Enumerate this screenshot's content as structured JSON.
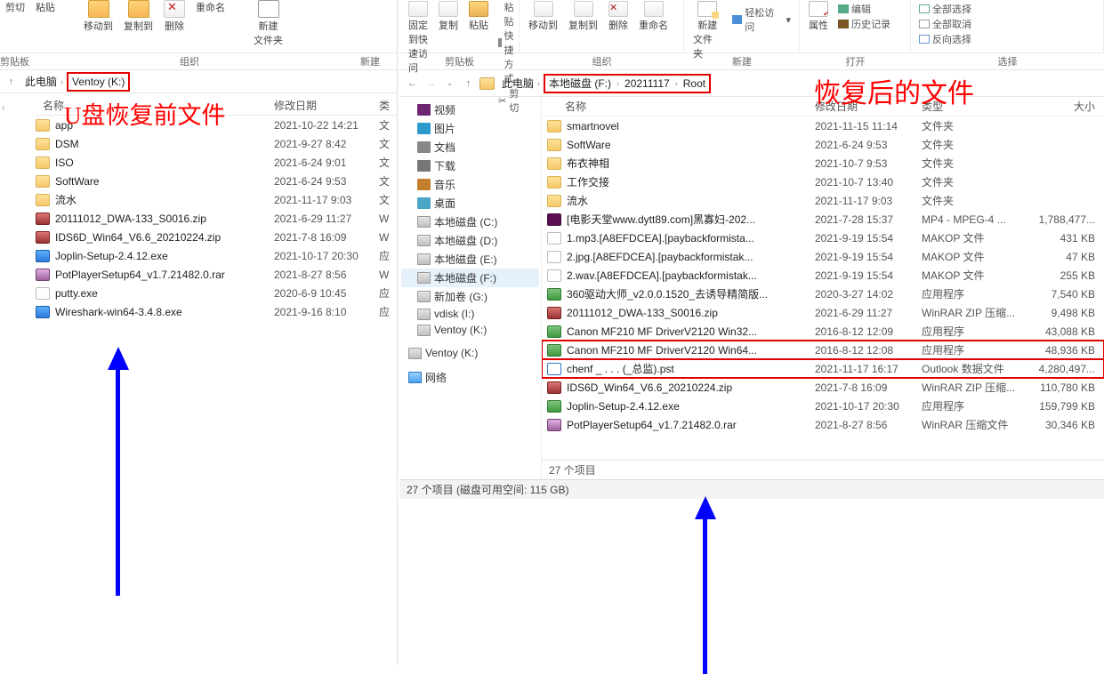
{
  "annotations": {
    "left_label": "U盘恢复前文件",
    "right_label": "恢复后的文件"
  },
  "left": {
    "ribbon": {
      "cut": "剪切",
      "paste": "粘贴",
      "move_to": "移动到",
      "copy_to": "复制到",
      "delete": "删除",
      "rename": "重命名",
      "new_folder_l1": "新建",
      "new_folder_l2": "文件夹",
      "group_clipboard": "剪贴板",
      "group_organize": "组织",
      "group_new": "新建"
    },
    "breadcrumb": {
      "pc": "此电脑",
      "drive": "Ventoy (K:)"
    },
    "header": {
      "name": "名称",
      "date": "修改日期",
      "type": "类"
    },
    "items": [
      {
        "name": "app",
        "date": "2021-10-22 14:21",
        "type": "文",
        "cls": ""
      },
      {
        "name": "DSM",
        "date": "2021-9-27 8:42",
        "type": "文",
        "cls": ""
      },
      {
        "name": "ISO",
        "date": "2021-6-24 9:01",
        "type": "文",
        "cls": ""
      },
      {
        "name": "SoftWare",
        "date": "2021-6-24 9:53",
        "type": "文",
        "cls": ""
      },
      {
        "name": "流水",
        "date": "2021-11-17 9:03",
        "type": "文",
        "cls": ""
      },
      {
        "name": "20111012_DWA-133_S0016.zip",
        "date": "2021-6-29 11:27",
        "type": "W",
        "cls": "zip"
      },
      {
        "name": "IDS6D_Win64_V6.6_20210224.zip",
        "date": "2021-7-8 16:09",
        "type": "W",
        "cls": "zip"
      },
      {
        "name": "Joplin-Setup-2.4.12.exe",
        "date": "2021-10-17 20:30",
        "type": "应",
        "cls": "exe"
      },
      {
        "name": "PotPlayerSetup64_v1.7.21482.0.rar",
        "date": "2021-8-27 8:56",
        "type": "W",
        "cls": "rar"
      },
      {
        "name": "putty.exe",
        "date": "2020-6-9 10:45",
        "type": "应",
        "cls": "generic"
      },
      {
        "name": "Wireshark-win64-3.4.8.exe",
        "date": "2021-9-16 8:10",
        "type": "应",
        "cls": "exe"
      }
    ]
  },
  "right": {
    "ribbon": {
      "pin_l1": "固定到快",
      "pin_l2": "速访问",
      "copy": "复制",
      "paste": "粘贴",
      "paste_shortcut": "粘贴快捷方式",
      "cut": "剪切",
      "move_to": "移动到",
      "copy_to": "复制到",
      "delete": "删除",
      "rename": "重命名",
      "new_folder_l1": "新建",
      "new_folder_l2": "文件夹",
      "easy_access": "轻松访问",
      "properties": "属性",
      "edit": "编辑",
      "history": "历史记录",
      "select_all": "全部选择",
      "select_none": "全部取消",
      "invert": "反向选择",
      "grp_clipboard": "剪贴板",
      "grp_organize": "组织",
      "grp_new": "新建",
      "grp_open": "打开",
      "grp_select": "选择"
    },
    "breadcrumb": {
      "pc": "此电脑",
      "drive": "本地磁盘 (F:)",
      "d1": "20211117",
      "d2": "Root"
    },
    "tree": {
      "video": "视频",
      "pictures": "图片",
      "documents": "文档",
      "downloads": "下载",
      "music": "音乐",
      "desktop": "桌面",
      "c": "本地磁盘 (C:)",
      "d": "本地磁盘 (D:)",
      "e": "本地磁盘 (E:)",
      "f": "本地磁盘 (F:)",
      "g": "新加卷 (G:)",
      "i": "vdisk (I:)",
      "k1": "Ventoy (K:)",
      "k2": "Ventoy (K:)",
      "net": "网络"
    },
    "header": {
      "name": "名称",
      "date": "修改日期",
      "type": "类型",
      "size": "大小"
    },
    "items": [
      {
        "name": "smartnovel",
        "date": "2021-11-15 11:14",
        "type": "文件夹",
        "size": "",
        "cls": ""
      },
      {
        "name": "SoftWare",
        "date": "2021-6-24 9:53",
        "type": "文件夹",
        "size": "",
        "cls": ""
      },
      {
        "name": "布衣神相",
        "date": "2021-10-7 9:53",
        "type": "文件夹",
        "size": "",
        "cls": ""
      },
      {
        "name": "工作交接",
        "date": "2021-10-7 13:40",
        "type": "文件夹",
        "size": "",
        "cls": ""
      },
      {
        "name": "流水",
        "date": "2021-11-17 9:03",
        "type": "文件夹",
        "size": "",
        "cls": ""
      },
      {
        "name": "[电影天堂www.dytt89.com]黑寡妇-202...",
        "date": "2021-7-28 15:37",
        "type": "MP4 - MPEG-4 ...",
        "size": "1,788,477...",
        "cls": "mp4"
      },
      {
        "name": "1.mp3.[A8EFDCEA].[paybackformista...",
        "date": "2021-9-19 15:54",
        "type": "MAKOP 文件",
        "size": "431 KB",
        "cls": "generic"
      },
      {
        "name": "2.jpg.[A8EFDCEA].[paybackformistak...",
        "date": "2021-9-19 15:54",
        "type": "MAKOP 文件",
        "size": "47 KB",
        "cls": "generic"
      },
      {
        "name": "2.wav.[A8EFDCEA].[paybackformistak...",
        "date": "2021-9-19 15:54",
        "type": "MAKOP 文件",
        "size": "255 KB",
        "cls": "generic"
      },
      {
        "name": "360驱动大师_v2.0.0.1520_去诱导精简版...",
        "date": "2020-3-27 14:02",
        "type": "应用程序",
        "size": "7,540 KB",
        "cls": "exe"
      },
      {
        "name": "20111012_DWA-133_S0016.zip",
        "date": "2021-6-29 11:27",
        "type": "WinRAR ZIP 压缩...",
        "size": "9,498 KB",
        "cls": "zip"
      },
      {
        "name": "Canon MF210 MF DriverV2120 Win32...",
        "date": "2016-8-12 12:09",
        "type": "应用程序",
        "size": "43,088 KB",
        "cls": "exe"
      },
      {
        "name": "Canon MF210 MF DriverV2120 Win64...",
        "date": "2016-8-12 12:08",
        "type": "应用程序",
        "size": "48,936 KB",
        "cls": "exe",
        "hl": true
      },
      {
        "name": "chenf    _ . . .  (_总监).pst",
        "date": "2021-11-17 16:17",
        "type": "Outlook 数据文件",
        "size": "4,280,497...",
        "cls": "pst",
        "hl": true
      },
      {
        "name": "IDS6D_Win64_V6.6_20210224.zip",
        "date": "2021-7-8 16:09",
        "type": "WinRAR ZIP 压缩...",
        "size": "110,780 KB",
        "cls": "zip"
      },
      {
        "name": "Joplin-Setup-2.4.12.exe",
        "date": "2021-10-17 20:30",
        "type": "应用程序",
        "size": "159,799 KB",
        "cls": "exe"
      },
      {
        "name": "PotPlayerSetup64_v1.7.21482.0.rar",
        "date": "2021-8-27 8:56",
        "type": "WinRAR 压缩文件",
        "size": "30,346 KB",
        "cls": "rar"
      }
    ],
    "count_text": "27 个项目",
    "status_text": "27 个项目 (磁盘可用空间: 115 GB)"
  }
}
